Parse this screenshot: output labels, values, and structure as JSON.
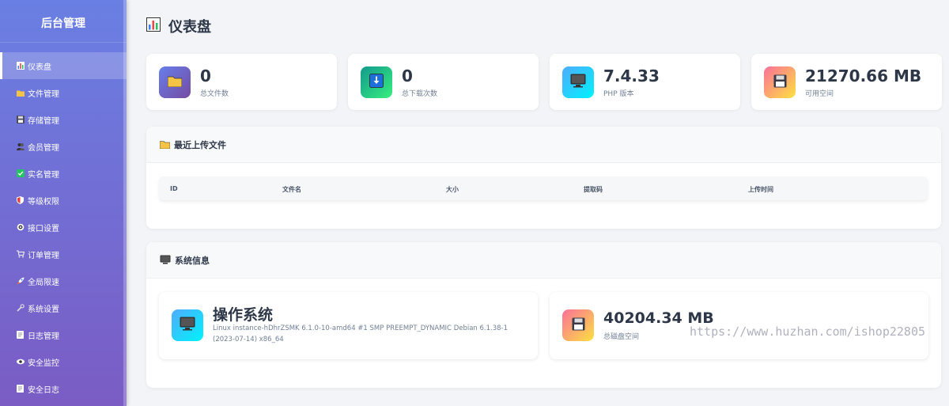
{
  "sidebar": {
    "title": "后台管理",
    "items": [
      {
        "label": "仪表盘",
        "icon": "bar-chart-icon",
        "active": true
      },
      {
        "label": "文件管理",
        "icon": "folder-icon"
      },
      {
        "label": "存储管理",
        "icon": "floppy-disk-icon"
      },
      {
        "label": "会员管理",
        "icon": "users-icon"
      },
      {
        "label": "实名管理",
        "icon": "check-icon"
      },
      {
        "label": "等级权限",
        "icon": "shield-icon"
      },
      {
        "label": "接口设置",
        "icon": "gear-icon"
      },
      {
        "label": "订单管理",
        "icon": "cart-icon"
      },
      {
        "label": "全局限速",
        "icon": "rocket-icon"
      },
      {
        "label": "系统设置",
        "icon": "wrench-icon"
      },
      {
        "label": "日志管理",
        "icon": "document-icon"
      },
      {
        "label": "安全监控",
        "icon": "eye-icon"
      },
      {
        "label": "安全日志",
        "icon": "document-icon"
      }
    ]
  },
  "header": {
    "title": "仪表盘",
    "icon": "bar-chart-icon"
  },
  "stats": [
    {
      "value": "0",
      "label": "总文件数",
      "icon": "folder-icon",
      "gradient": [
        "#667eea",
        "#764ba2"
      ]
    },
    {
      "value": "0",
      "label": "总下载次数",
      "icon": "download-icon",
      "gradient": [
        "#11998e",
        "#38ef7d"
      ]
    },
    {
      "value": "7.4.33",
      "label": "PHP 版本",
      "icon": "monitor-icon",
      "gradient": [
        "#4facfe",
        "#00f2fe"
      ]
    },
    {
      "value": "21270.66 MB",
      "label": "可用空间",
      "icon": "floppy-disk-icon",
      "gradient": [
        "#fa709a",
        "#fee140"
      ]
    }
  ],
  "recent_uploads": {
    "title": "最近上传文件",
    "icon": "folder-icon",
    "columns": [
      "ID",
      "文件名",
      "大小",
      "提取码",
      "上传时间"
    ],
    "rows": []
  },
  "system_info": {
    "title": "系统信息",
    "icon": "monitor-icon",
    "os": {
      "title": "操作系统",
      "detail": "Linux instance-hDhrZSMK 6.1.0-10-amd64 #1 SMP PREEMPT_DYNAMIC Debian 6.1.38-1 (2023-07-14) x86_64"
    },
    "disk": {
      "value": "40204.34 MB",
      "label": "总磁盘空间"
    }
  },
  "watermark": "https://www.huzhan.com/ishop22805",
  "colors": {
    "sidebar_top": "#6a7fe3",
    "sidebar_bottom": "#7a5cc4",
    "background": "#f2f4f8",
    "text_dark": "#2d3748"
  }
}
